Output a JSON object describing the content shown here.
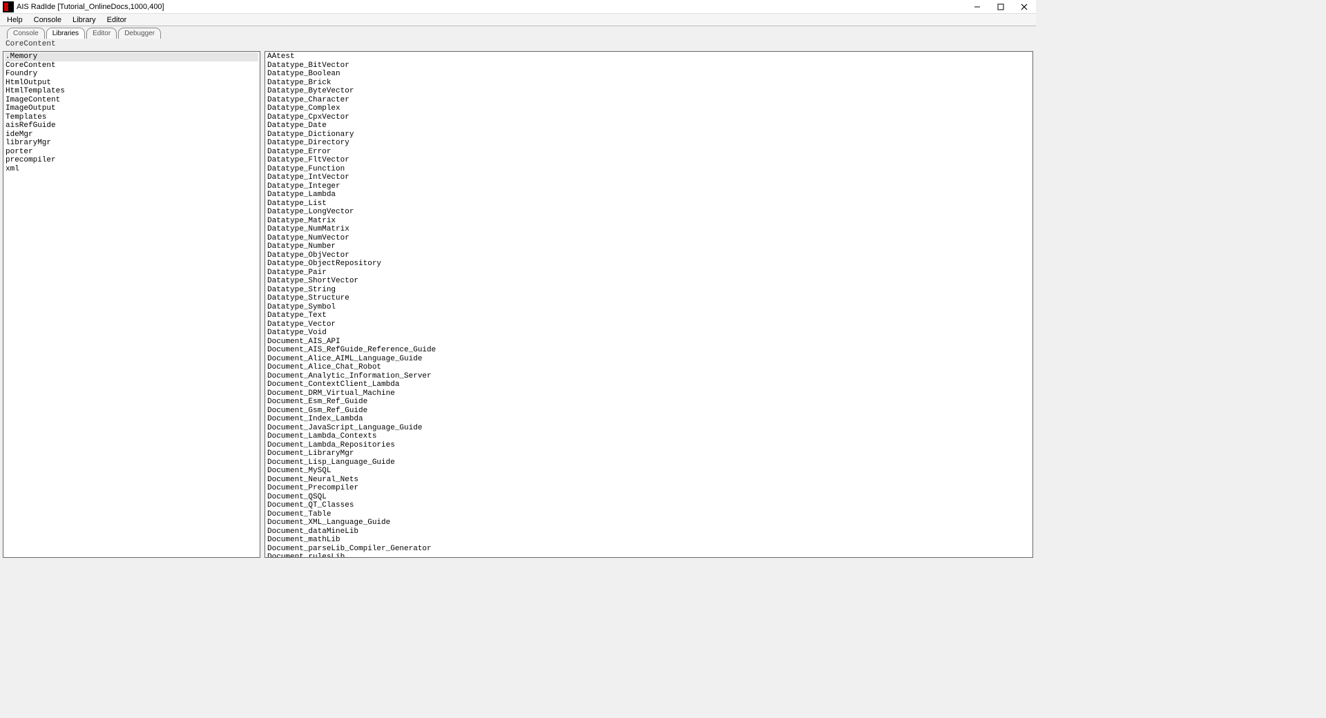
{
  "window": {
    "title": "AIS RadIde [Tutorial_OnlineDocs,1000,400]"
  },
  "menubar": {
    "items": [
      "Help",
      "Console",
      "Library",
      "Editor"
    ]
  },
  "tabs": {
    "items": [
      "Console",
      "Libraries",
      "Editor",
      "Debugger"
    ],
    "active_index": 1
  },
  "breadcrumb": "CoreContent",
  "left_list": {
    "selected_index": 0,
    "items": [
      ".Memory",
      "CoreContent",
      "Foundry",
      "HtmlOutput",
      "HtmlTemplates",
      "ImageContent",
      "ImageOutput",
      "Templates",
      "aisRefGuide",
      "ideMgr",
      "libraryMgr",
      "porter",
      "precompiler",
      "xml"
    ]
  },
  "right_list": {
    "items": [
      "AAtest",
      "Datatype_BitVector",
      "Datatype_Boolean",
      "Datatype_Brick",
      "Datatype_ByteVector",
      "Datatype_Character",
      "Datatype_Complex",
      "Datatype_CpxVector",
      "Datatype_Date",
      "Datatype_Dictionary",
      "Datatype_Directory",
      "Datatype_Error",
      "Datatype_FltVector",
      "Datatype_Function",
      "Datatype_IntVector",
      "Datatype_Integer",
      "Datatype_Lambda",
      "Datatype_List",
      "Datatype_LongVector",
      "Datatype_Matrix",
      "Datatype_NumMatrix",
      "Datatype_NumVector",
      "Datatype_Number",
      "Datatype_ObjVector",
      "Datatype_ObjectRepository",
      "Datatype_Pair",
      "Datatype_ShortVector",
      "Datatype_String",
      "Datatype_Structure",
      "Datatype_Symbol",
      "Datatype_Text",
      "Datatype_Vector",
      "Datatype_Void",
      "Document_AIS_API",
      "Document_AIS_RefGuide_Reference_Guide",
      "Document_Alice_AIML_Language_Guide",
      "Document_Alice_Chat_Robot",
      "Document_Analytic_Information_Server",
      "Document_ContextClient_Lambda",
      "Document_DRM_Virtual_Machine",
      "Document_Esm_Ref_Guide",
      "Document_Gsm_Ref_Guide",
      "Document_Index_Lambda",
      "Document_JavaScript_Language_Guide",
      "Document_Lambda_Contexts",
      "Document_Lambda_Repositories",
      "Document_LibraryMgr",
      "Document_Lisp_Language_Guide",
      "Document_MySQL",
      "Document_Neural_Nets",
      "Document_Precompiler",
      "Document_QSQL",
      "Document_QT_Classes",
      "Document_Table",
      "Document_XML_Language_Guide",
      "Document_dataMineLib",
      "Document_mathLib",
      "Document_parseLib_Compiler_Generator",
      "Document_rulesLib"
    ]
  }
}
